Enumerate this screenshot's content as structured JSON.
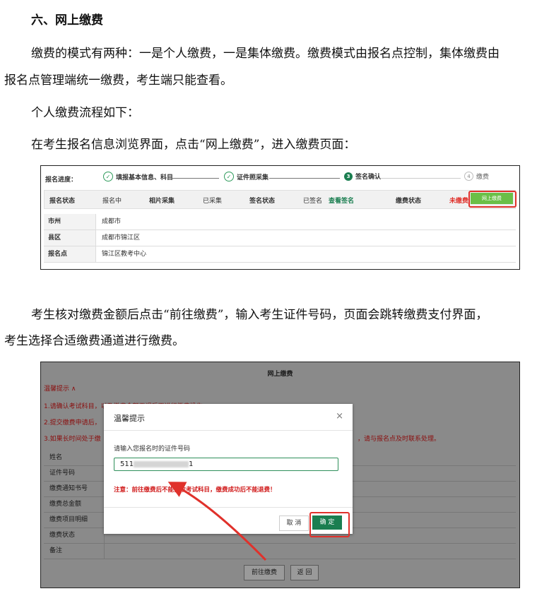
{
  "heading": "六、网上缴费",
  "para1_line1": "缴费的模式有两种：一是个人缴费，一是集体缴费。缴费模式由报名点控制，集体缴费由",
  "para1_line2": "报名点管理端统一缴费，考生端只能查看。",
  "para2": "个人缴费流程如下：",
  "para3": "在考生报名信息浏览界面，点击“网上缴费”，进入缴费页面：",
  "para4_line1": "考生核对缴费金额后点击“前往缴费”，输入考生证件号码，页面会跳转缴费支付界面，",
  "para4_line2": "考生选择合适缴费通道进行缴费。",
  "screenshot1": {
    "progress_label": "报名进度：",
    "steps": [
      {
        "label": "填报基本信息、科目",
        "icon": "check-icon"
      },
      {
        "label": "证件照采集",
        "icon": "check-icon"
      },
      {
        "label": "签名确认",
        "number": "3"
      },
      {
        "label": "缴费",
        "number": "4"
      }
    ],
    "header": {
      "status_label": "报名状态",
      "status_value": "报名中",
      "photo_label": "相片采集",
      "photo_value": "已采集",
      "sign_label": "签名状态",
      "sign_value": "已签名",
      "sign_link": "查看签名",
      "pay_label": "缴费状态",
      "pay_value": "未缴费",
      "pay_button": "网上缴费"
    },
    "rows": [
      {
        "key": "市州",
        "value": "成都市"
      },
      {
        "key": "县区",
        "value": "成都市锦江区"
      },
      {
        "key": "报名点",
        "value": "锦江区教考中心"
      }
    ]
  },
  "screenshot2": {
    "title": "网上缴费",
    "tips_toggle": "温馨提示 ∧",
    "tip1": "1.请确认考试科目，以及缴费金额无误后再进行缴费操作。",
    "tip2": "2.提交缴费申请后，",
    "tip3": "3.如果长时间处于缴",
    "tip3_tail": "，请与报名点及时联系处理。",
    "table_keys": [
      "姓名",
      "证件号码",
      "缴费通知书号",
      "缴费总金额",
      "缴费项目明细",
      "缴费状态",
      "备注"
    ],
    "go_pay_button": "前往缴费",
    "back_button": "返 回",
    "modal": {
      "title": "温馨提示",
      "close": "×",
      "input_label": "请输入您报名时的证件号码",
      "input_prefix": "511",
      "input_suffix": "1",
      "warning": "注意：前往缴费后不能修改考试科目，缴费成功后不能退费！",
      "cancel": "取 消",
      "confirm": "确 定"
    }
  },
  "colors": {
    "accent_green": "#1a7e50",
    "highlight_red": "#e0312b",
    "warning_red": "#d01919"
  }
}
